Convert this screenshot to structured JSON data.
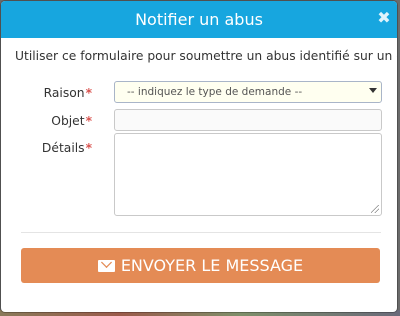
{
  "modal": {
    "title": "Notifier un abus",
    "close_symbol": "✖",
    "intro_text": "Utiliser ce formulaire pour soumettre un abus identifié sur un contenu ."
  },
  "form": {
    "required_marker": "*",
    "reason": {
      "label": "Raison",
      "selected_option": "-- indiquez le type de demande --"
    },
    "subject": {
      "label": "Objet",
      "value": ""
    },
    "details": {
      "label": "Détails",
      "value": ""
    },
    "submit_label": "ENVOYER LE MESSAGE"
  },
  "icons": {
    "close": "close-icon",
    "submit": "envelope-icon"
  },
  "colors": {
    "header": "#17a6df",
    "submit_button": "#e48b55",
    "required": "#d9534f"
  }
}
